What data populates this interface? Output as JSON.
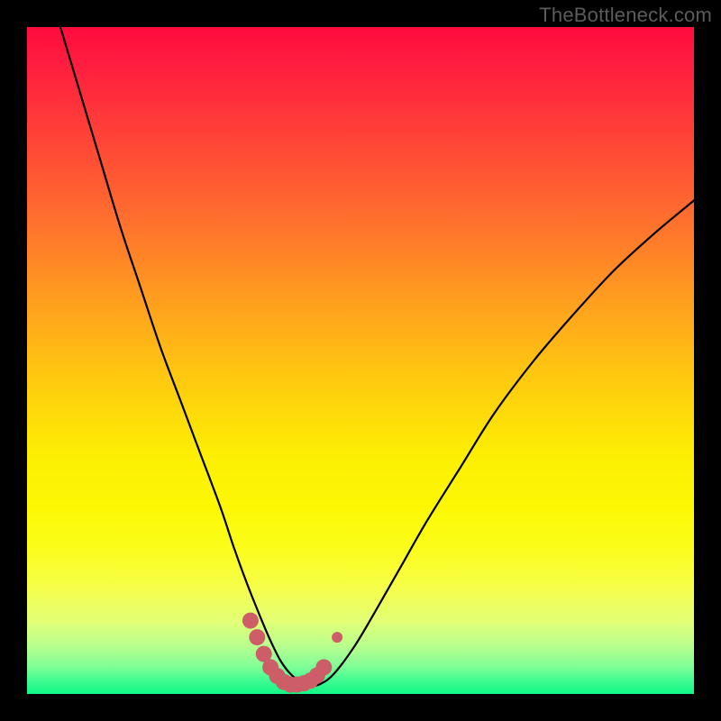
{
  "watermark": "TheBottleneck.com",
  "colors": {
    "background": "#000000",
    "curve": "#000000",
    "marker": "#cd5d66",
    "gradient_top": "#ff0b3e",
    "gradient_bottom": "#11f787"
  },
  "chart_data": {
    "type": "line",
    "title": "",
    "xlabel": "",
    "ylabel": "",
    "xlim": [
      0,
      100
    ],
    "ylim": [
      0,
      100
    ],
    "grid": false,
    "legend": false,
    "annotations": [],
    "series": [
      {
        "name": "bottleneck-curve",
        "x": [
          5,
          8,
          11,
          14,
          17,
          20,
          23,
          26,
          29,
          31,
          33,
          35,
          36.5,
          38,
          39.5,
          41,
          42.5,
          44,
          46,
          49,
          52,
          56,
          60,
          65,
          70,
          76,
          82,
          88,
          94,
          100
        ],
        "y": [
          100,
          90,
          80,
          70,
          61,
          52,
          44,
          36,
          28,
          22,
          16.5,
          11.5,
          8,
          5,
          3,
          1.8,
          1.2,
          1.5,
          3,
          7,
          12,
          19,
          26,
          34,
          42,
          50,
          57,
          63.5,
          69,
          74
        ]
      }
    ],
    "markers": {
      "name": "highlight-band",
      "x": [
        33.5,
        34.5,
        35.5,
        36.5,
        37.5,
        38.5,
        39.5,
        40.5,
        41.5,
        42.5,
        43.5,
        44.5,
        46.5
      ],
      "y": [
        11.0,
        8.5,
        6.0,
        4.0,
        2.7,
        1.8,
        1.4,
        1.4,
        1.6,
        2.0,
        2.8,
        4.0,
        8.5
      ],
      "radius": [
        9,
        9,
        9,
        9,
        9,
        9,
        9,
        9,
        9,
        9,
        9,
        9,
        6
      ]
    }
  }
}
